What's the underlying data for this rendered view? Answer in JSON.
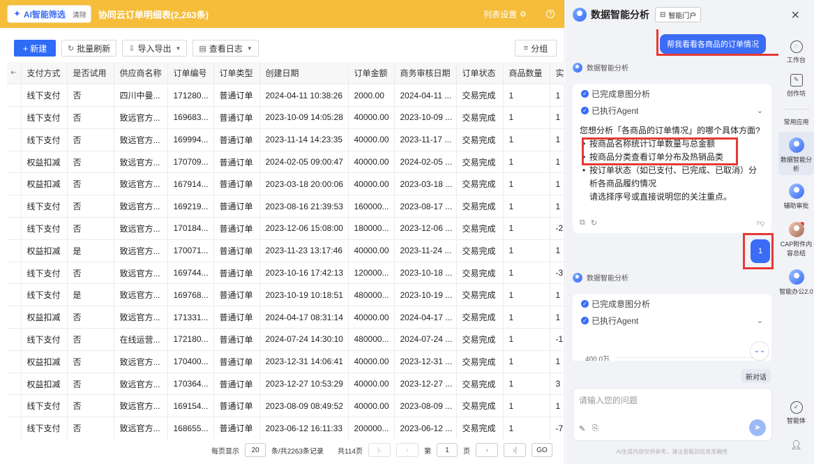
{
  "topbar": {
    "ai_label": "AI智能筛选",
    "ai_clear": "清除",
    "title": "协同云订单明细表(2,263条)",
    "list_settings": "列表设置",
    "gear_icon": "gear-icon",
    "help_icon": "?"
  },
  "toolbar": {
    "new_label": "新建",
    "batch_refresh": "批量刷新",
    "import_export": "导入导出",
    "view_log": "查看日志",
    "group": "分组"
  },
  "table": {
    "columns": [
      "支付方式",
      "是否试用",
      "供应商名称",
      "订单编号",
      "订单类型",
      "创建日期",
      "订单金额",
      "商务审核日期",
      "订单状态",
      "商品数量",
      "实"
    ],
    "rows": [
      [
        "线下支付",
        "否",
        "四川中曼...",
        "171280...",
        "普通订单",
        "2024-04-11 10:38:26",
        "2000.00",
        "2024-04-11 ...",
        "交易完成",
        "1",
        "1"
      ],
      [
        "线下支付",
        "否",
        "致远官方...",
        "169683...",
        "普通订单",
        "2023-10-09 14:05:28",
        "40000.00",
        "2023-10-09 ...",
        "交易完成",
        "1",
        "1"
      ],
      [
        "线下支付",
        "否",
        "致远官方...",
        "169994...",
        "普通订单",
        "2023-11-14 14:23:35",
        "40000.00",
        "2023-11-17 ...",
        "交易完成",
        "1",
        "1"
      ],
      [
        "权益扣减",
        "否",
        "致远官方...",
        "170709...",
        "普通订单",
        "2024-02-05 09:00:47",
        "40000.00",
        "2024-02-05 ...",
        "交易完成",
        "1",
        "1"
      ],
      [
        "权益扣减",
        "否",
        "致远官方...",
        "167914...",
        "普通订单",
        "2023-03-18 20:00:06",
        "40000.00",
        "2023-03-18 ...",
        "交易完成",
        "1",
        "1"
      ],
      [
        "线下支付",
        "否",
        "致远官方...",
        "169219...",
        "普通订单",
        "2023-08-16 21:39:53",
        "160000...",
        "2023-08-17 ...",
        "交易完成",
        "1",
        "1"
      ],
      [
        "线下支付",
        "否",
        "致远官方...",
        "170184...",
        "普通订单",
        "2023-12-06 15:08:00",
        "180000...",
        "2023-12-06 ...",
        "交易完成",
        "1",
        "-2"
      ],
      [
        "权益扣减",
        "是",
        "致远官方...",
        "170071...",
        "普通订单",
        "2023-11-23 13:17:46",
        "40000.00",
        "2023-11-24 ...",
        "交易完成",
        "1",
        "1"
      ],
      [
        "线下支付",
        "否",
        "致远官方...",
        "169744...",
        "普通订单",
        "2023-10-16 17:42:13",
        "120000...",
        "2023-10-18 ...",
        "交易完成",
        "1",
        "-3"
      ],
      [
        "线下支付",
        "是",
        "致远官方...",
        "169768...",
        "普通订单",
        "2023-10-19 10:18:51",
        "480000...",
        "2023-10-19 ...",
        "交易完成",
        "1",
        "1"
      ],
      [
        "权益扣减",
        "否",
        "致远官方...",
        "171331...",
        "普通订单",
        "2024-04-17 08:31:14",
        "40000.00",
        "2024-04-17 ...",
        "交易完成",
        "1",
        "1"
      ],
      [
        "线下支付",
        "否",
        "在线运营...",
        "172180...",
        "普通订单",
        "2024-07-24 14:30:10",
        "480000...",
        "2024-07-24 ...",
        "交易完成",
        "1",
        "-1"
      ],
      [
        "权益扣减",
        "否",
        "致远官方...",
        "170400...",
        "普通订单",
        "2023-12-31 14:06:41",
        "40000.00",
        "2023-12-31 ...",
        "交易完成",
        "1",
        "1"
      ],
      [
        "权益扣减",
        "否",
        "致远官方...",
        "170364...",
        "普通订单",
        "2023-12-27 10:53:29",
        "40000.00",
        "2023-12-27 ...",
        "交易完成",
        "1",
        "3"
      ],
      [
        "线下支付",
        "否",
        "致远官方...",
        "169154...",
        "普通订单",
        "2023-08-09 08:49:52",
        "40000.00",
        "2023-08-09 ...",
        "交易完成",
        "1",
        "1"
      ],
      [
        "线下支付",
        "否",
        "致远官方...",
        "168655...",
        "普通订单",
        "2023-06-12 16:11:33",
        "200000...",
        "2023-06-12 ...",
        "交易完成",
        "1",
        "-7"
      ]
    ]
  },
  "pager": {
    "per_page_label": "每页显示",
    "per_page_value": "20",
    "total_text": "条/共2263条记录",
    "pages_text": "共114页",
    "page_prefix": "第",
    "page_value": "1",
    "page_suffix": "页",
    "go": "GO"
  },
  "panel": {
    "title": "数据智能分析",
    "portal": "智能门户",
    "user_question": "帮我看看各商品的订单情况",
    "bot_name": "数据智能分析",
    "step1": "已完成意图分析",
    "step2": "已执行Agent",
    "answer_intro": "您想分析「各商品的订单情况」的哪个具体方面?",
    "options": [
      "按商品名称统计订单数量与总金额",
      "按商品分类查看订单分布及热销品类",
      "按订单状态（如已支付、已完成、已取消）分析各商品履约情况"
    ],
    "answer_outro": "请选择序号或直接说明您的关注重点。",
    "user_reply": "1",
    "bot_name2": "数据智能分析",
    "step1b": "已完成意图分析",
    "step2b": "已执行Agent",
    "chart_tick": "400.0万",
    "new_chat": "新对话",
    "input_placeholder": "请输入您的问题",
    "disclaimer": "AI生成内容仅供参考，请注意甄别信息准确性"
  },
  "rail": {
    "workbench": "工作台",
    "creative": "创作坊",
    "common_apps": "常用应用",
    "apps": [
      "数据智能分析",
      "辅助审批",
      "CAP附件内容总结",
      "智能办公2.0"
    ],
    "agent": "智能体"
  },
  "colors": {
    "topbar": "#f5bd3a",
    "primary": "#2f6bf5",
    "highlight": "#e53935"
  }
}
